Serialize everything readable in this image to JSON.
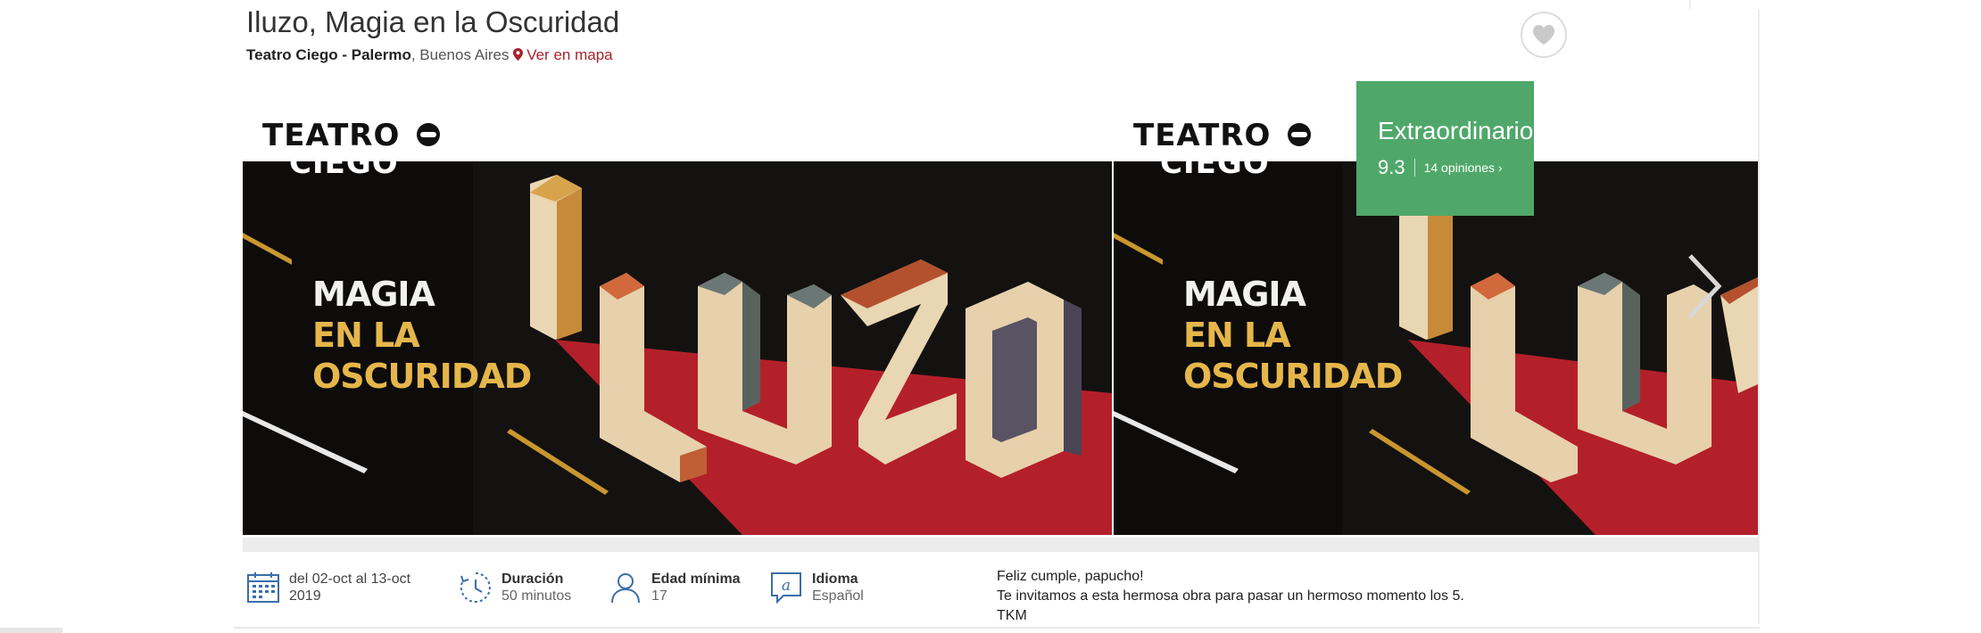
{
  "event": {
    "title": "Iluzo, Magia en la Oscuridad",
    "venue": "Teatro Ciego - Palermo",
    "city": ", Buenos Aires",
    "map_link": "Ver en mapa"
  },
  "icons": {
    "favorite": "heart-icon",
    "map": "map-pin-icon",
    "next": "chevron-right-icon",
    "dates": "calendar-icon",
    "duration": "clock-icon",
    "age": "user-icon",
    "language": "speech-bubble-icon"
  },
  "rating": {
    "label": "Extraordinario",
    "score": "9.3",
    "reviews": "14 opiniones ›",
    "color": "#4fa86a"
  },
  "slides": [
    {
      "logo_top": "TEATRO",
      "logo_bottom": "CIEGO",
      "line1": "MAGIA",
      "line2": "EN LA",
      "line3": "OSCURIDAD"
    },
    {
      "logo_top": "TEATRO",
      "logo_bottom": "CIEGO",
      "line1": "MAGIA",
      "line2": "EN LA",
      "line3": "OSCURIDAD"
    }
  ],
  "info": {
    "dates": {
      "line1": "del 02-oct al 13-oct",
      "line2": "2019"
    },
    "duration": {
      "label": "Duración",
      "value": "50 minutos"
    },
    "age": {
      "label": "Edad mínima",
      "value": "17"
    },
    "language": {
      "label": "Idioma",
      "value": "Español"
    }
  },
  "message": {
    "line1": "Feliz cumple, papucho!",
    "line2": "Te invitamos a esta hermosa obra para pasar un hermoso momento los 5.",
    "line3": "TKM"
  },
  "colors": {
    "accent_red": "#a8232a",
    "icon_blue": "#3a6ea8",
    "stage_red": "#b4202a",
    "gold": "#e5b64a"
  }
}
